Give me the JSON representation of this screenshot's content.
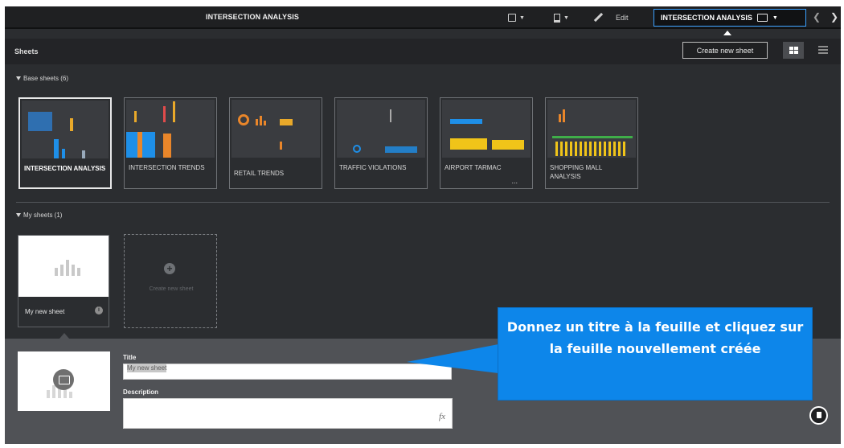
{
  "topbar": {
    "app_title": "INTERSECTION ANALYSIS",
    "edit_label": "Edit",
    "current_sheet": "INTERSECTION ANALYSIS"
  },
  "sheets_bar": {
    "label": "Sheets",
    "create_new_sheet": "Create new sheet"
  },
  "base_sheets": {
    "heading": "Base sheets (6)",
    "items": [
      {
        "label": "INTERSECTION ANALYSIS",
        "selected": true
      },
      {
        "label": "INTERSECTION TRENDS"
      },
      {
        "label": "RETAIL TRENDS"
      },
      {
        "label": "TRAFFIC VIOLATIONS"
      },
      {
        "label": "AIRPORT TARMAC",
        "ellipsis": "..."
      },
      {
        "label": "SHOPPING MALL ANALYSIS"
      }
    ]
  },
  "my_sheets": {
    "heading": "My sheets (1)",
    "items": [
      {
        "label": "My new sheet"
      }
    ],
    "create_new_label": "Create new sheet"
  },
  "detail": {
    "title_label": "Title",
    "title_value": "My new sheet",
    "description_label": "Description",
    "fx_label": "fx"
  },
  "callout": {
    "text": "Donnez un titre à la feuille et cliquez sur la feuille nouvellement créée"
  },
  "colors": {
    "accent": "#3aa0ff",
    "callout_bg": "#0d86ea",
    "panel_bg": "#2b2d30",
    "detail_bg": "#505256"
  }
}
